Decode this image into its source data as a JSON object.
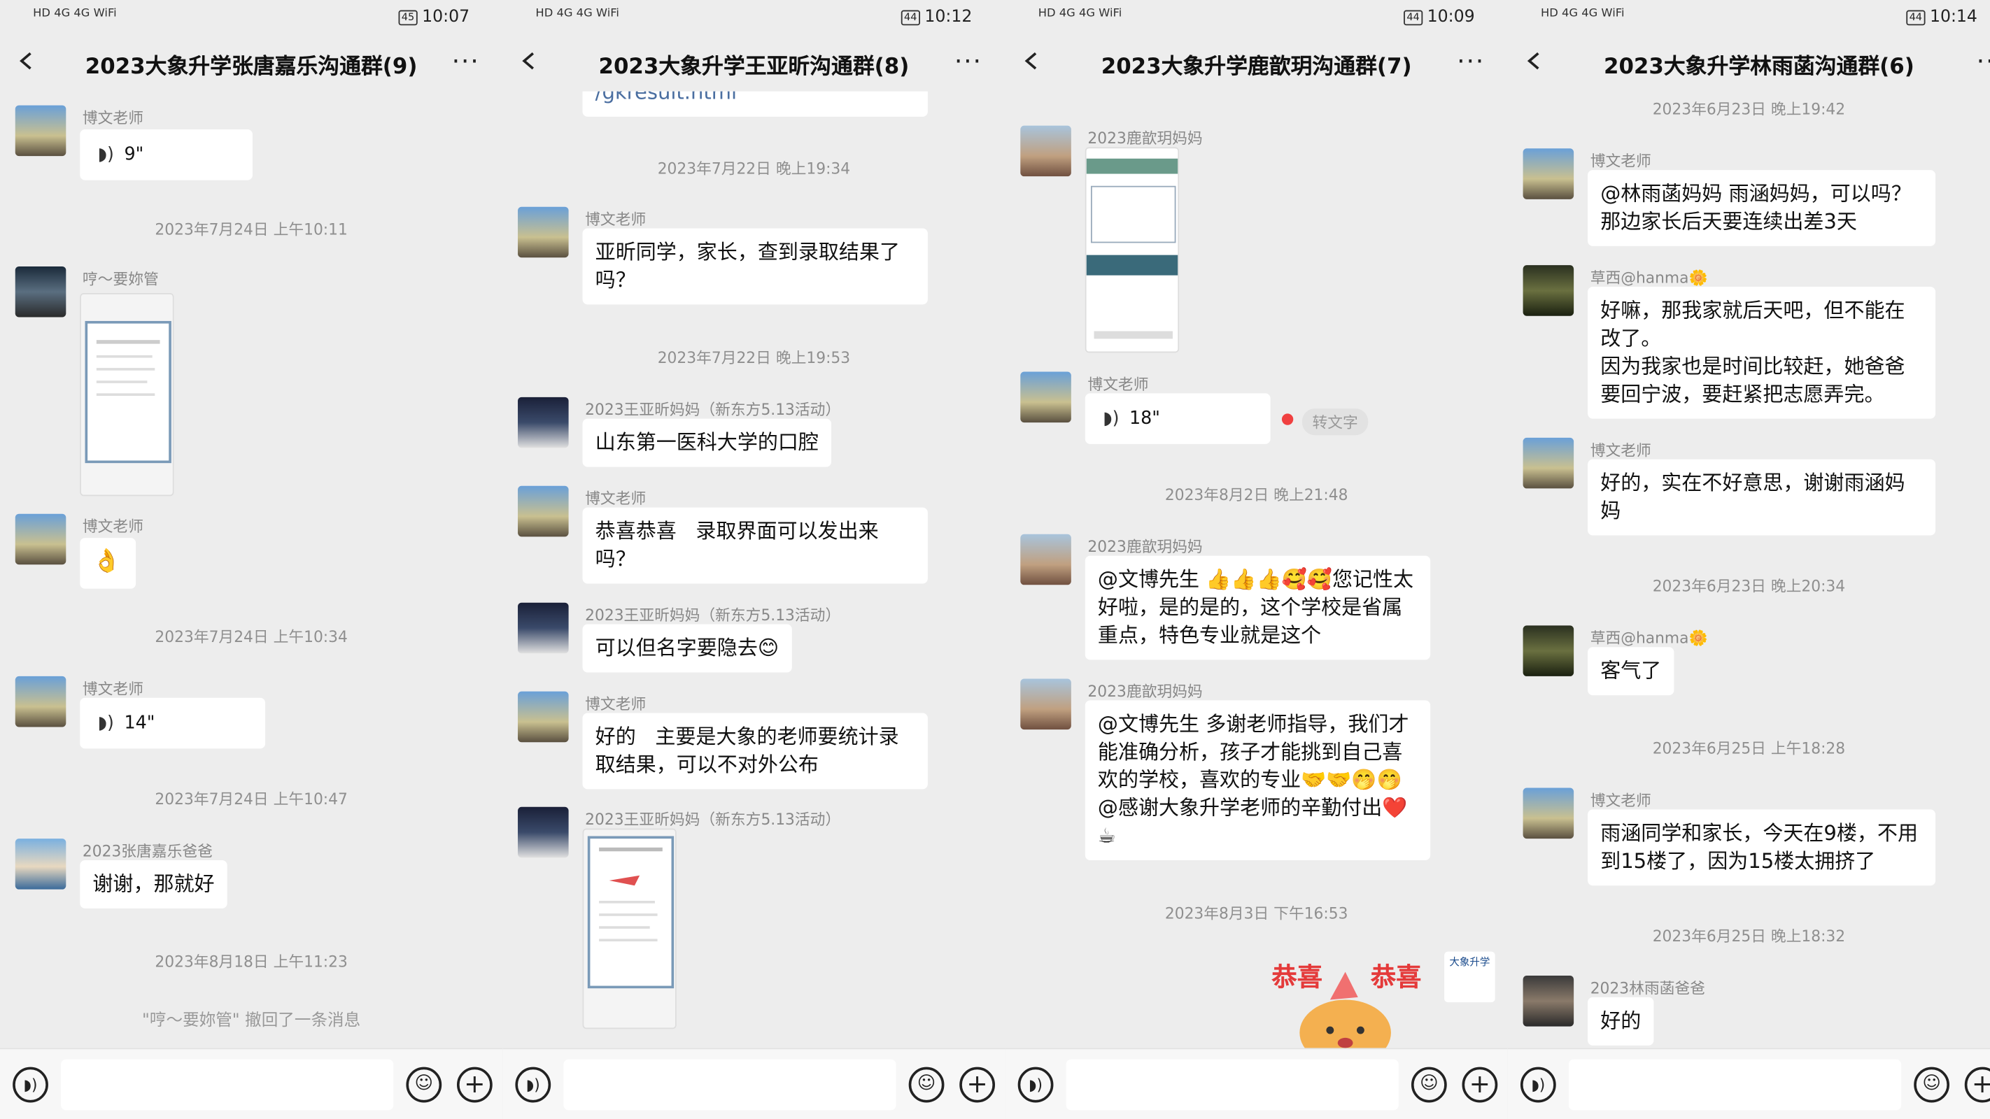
{
  "panels": [
    {
      "status": {
        "time": "10:07",
        "battery": "45",
        "icons": "HD 4G 4G WiFi"
      },
      "title": "2023大象升学张唐嘉乐沟通群(9)",
      "messages": {
        "m1_sender": "博文老师",
        "m1_voice": "9\"",
        "ts1": "2023年7月24日 上午10:11",
        "m2_sender": "哼～要妳管",
        "m3_sender": "博文老师",
        "m3_emoji": "👌",
        "ts2": "2023年7月24日 上午10:34",
        "m4_sender": "博文老师",
        "m4_voice": "14\"",
        "ts3": "2023年7月24日 上午10:47",
        "m5_sender": "2023张唐嘉乐爸爸",
        "m5_text": "谢谢，那就好",
        "ts4": "2023年8月18日 上午11:23",
        "recall": "\"哼～要妳管\" 撤回了一条消息"
      }
    },
    {
      "status": {
        "time": "10:12",
        "battery": "44",
        "icons": "HD 4G 4G WiFi"
      },
      "title": "2023大象升学王亚昕沟通群(8)",
      "messages": {
        "link_text": "/gkresult.html",
        "ts1": "2023年7月22日 晚上19:34",
        "m1_sender": "博文老师",
        "m1_text": "亚昕同学，家长，查到录取结果了吗？",
        "ts2": "2023年7月22日 晚上19:53",
        "m2_sender": "2023王亚昕妈妈（新东方5.13活动）",
        "m2_text": "山东第一医科大学的口腔",
        "m3_sender": "博文老师",
        "m3_text": "恭喜恭喜   录取界面可以发出来吗？",
        "m4_sender": "2023王亚昕妈妈（新东方5.13活动）",
        "m4_text": "可以但名字要隐去😊",
        "m5_sender": "博文老师",
        "m5_text": "好的   主要是大象的老师要统计录取结果，可以不对外公布",
        "m6_sender": "2023王亚昕妈妈（新东方5.13活动）"
      }
    },
    {
      "status": {
        "time": "10:09",
        "battery": "44",
        "icons": "HD 4G 4G WiFi"
      },
      "title": "2023大象升学鹿歆玥沟通群(7)",
      "messages": {
        "m1_sender": "2023鹿歆玥妈妈",
        "m2_sender": "博文老师",
        "m2_voice": "18\"",
        "transcribe": "转文字",
        "ts1": "2023年8月2日 晚上21:48",
        "m3_sender": "2023鹿歆玥妈妈",
        "m3_text": "@文博先生 👍👍👍🥰🥰您记性太好啦，是的是的，这个学校是省属重点，特色专业就是这个",
        "m4_sender": "2023鹿歆玥妈妈",
        "m4_text": "@文博先生 多谢老师指导，我们才能准确分析，孩子才能挑到自己喜欢的学校，喜欢的专业🤝🤝🤭🤭@感谢大象升学老师的辛勤付出❤️☕",
        "ts2": "2023年8月3日 下午16:53",
        "sticker_left": "恭喜",
        "sticker_right": "恭喜",
        "logo_text": "大象升学"
      }
    },
    {
      "status": {
        "time": "10:14",
        "battery": "44",
        "icons": "HD 4G 4G WiFi"
      },
      "title": "2023大象升学林雨菡沟通群(6)",
      "messages": {
        "ts0": "2023年6月23日 晚上19:42",
        "m1_sender": "博文老师",
        "m1_text": "@林雨菡妈妈 雨涵妈妈，可以吗？那边家长后天要连续出差3天",
        "m2_sender": "草西@hanma🌼",
        "m2_text": "好嘛，那我家就后天吧，但不能在改了。\n因为我家也是时间比较赶，她爸爸要回宁波，要赶紧把志愿弄完。",
        "m3_sender": "博文老师",
        "m3_text": "好的，实在不好意思，谢谢雨涵妈妈",
        "ts1": "2023年6月23日 晚上20:34",
        "m4_sender": "草西@hanma🌼",
        "m4_text": "客气了",
        "ts2": "2023年6月25日 上午18:28",
        "m5_sender": "博文老师",
        "m5_text": "雨涵同学和家长，今天在9楼，不用到15楼了，因为15楼太拥挤了",
        "ts3": "2023年6月25日 晚上18:32",
        "m6_sender": "2023林雨菡爸爸",
        "m6_text": "好的"
      }
    }
  ]
}
